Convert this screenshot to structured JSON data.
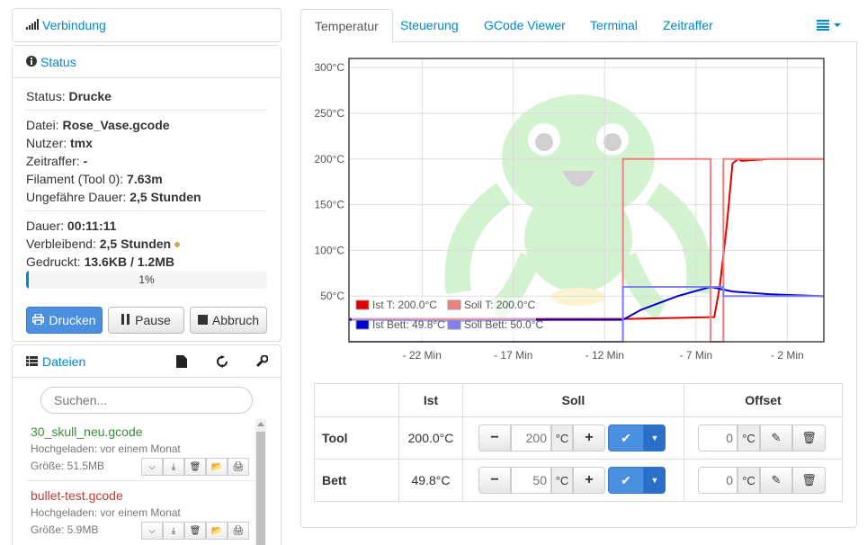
{
  "sidebar": {
    "connection_title": "Verbindung",
    "status_title": "Status",
    "status": {
      "label": "Status:",
      "value": "Drucke"
    },
    "job": [
      {
        "label": "Datei:",
        "value": "Rose_Vase.gcode"
      },
      {
        "label": "Nutzer:",
        "value": "tmx"
      },
      {
        "label": "Zeitraffer:",
        "value": "-"
      },
      {
        "label": "Filament (Tool 0):",
        "value": "7.63m"
      },
      {
        "label": "Ungefähre Dauer:",
        "value": "2,5 Stunden"
      }
    ],
    "progress_info": [
      {
        "label": "Dauer:",
        "value": "00:11:11"
      },
      {
        "label": "Verbleibend:",
        "value": "2,5 Stunden"
      },
      {
        "label": "Gedruckt:",
        "value": "13.6KB / 1.2MB"
      }
    ],
    "progress_text": "1%",
    "progress_value": 0.01,
    "buttons": {
      "print": "Drucken",
      "pause": "Pause",
      "cancel": "Abbruch"
    },
    "files_title": "Dateien",
    "search_placeholder": "Suchen...",
    "files": [
      {
        "name": "30_skull_neu.gcode",
        "uploaded": "Hochgeladen: vor einem Monat",
        "size": "Größe: 51.5MB",
        "color": "#3c8b3c"
      },
      {
        "name": "bullet-test.gcode",
        "uploaded": "Hochgeladen: vor einem Monat",
        "size": "Größe: 5.9MB",
        "color": "#c0392b"
      }
    ]
  },
  "tabs": [
    "Temperatur",
    "Steuerung",
    "GCode Viewer",
    "Terminal",
    "Zeitraffer"
  ],
  "chart_data": {
    "type": "line",
    "title": "",
    "xlabel": "",
    "ylabel": "",
    "x_ticks": [
      "- 22 Min",
      "- 17 Min",
      "- 12 Min",
      "- 7 Min",
      "- 2 Min"
    ],
    "y_ticks": [
      "50°C",
      "100°C",
      "150°C",
      "200°C",
      "250°C",
      "300°C"
    ],
    "xlim": [
      -26,
      0
    ],
    "ylim": [
      0,
      310
    ],
    "grid": true,
    "legend_position": "bottom-left",
    "series": [
      {
        "name": "Ist T: 200.0°C",
        "color": "#e00000",
        "x": [
          -26,
          -11,
          -10.8,
          -6,
          -5.7,
          -5.3,
          -5,
          -4.7,
          -4.5,
          -3,
          0
        ],
        "y": [
          25,
          25,
          25,
          27,
          60,
          130,
          195,
          200,
          198,
          200,
          200
        ]
      },
      {
        "name": "Soll T: 200.0°C",
        "color": "#f08080",
        "x": [
          -26,
          -11,
          -11,
          -6.2,
          -6.2,
          0
        ],
        "y": [
          0,
          0,
          200,
          200,
          200,
          200
        ],
        "step_points": [
          [
            -26,
            0
          ],
          [
            -11,
            0
          ],
          [
            -11,
            200
          ],
          [
            -6.2,
            200
          ],
          [
            -6.2,
            0
          ],
          [
            -5.5,
            0
          ],
          [
            -5.5,
            200
          ],
          [
            0,
            200
          ]
        ]
      },
      {
        "name": "Ist Bett: 49.8°C",
        "color": "#0000cc",
        "x": [
          -26,
          -20,
          -15,
          -11,
          -10,
          -8,
          -6.2,
          -5,
          -3,
          0
        ],
        "y": [
          24,
          23,
          24,
          24,
          35,
          50,
          60,
          55,
          52,
          49.8
        ]
      },
      {
        "name": "Soll Bett: 50.0°C",
        "color": "#8080f0",
        "x": [
          -26,
          -11,
          -11,
          -5.5,
          -5.5,
          0
        ],
        "y": [
          0,
          0,
          60,
          60,
          50,
          50
        ]
      }
    ]
  },
  "temp_table": {
    "headers": [
      "",
      "Ist",
      "Soll",
      "Offset"
    ],
    "rows": [
      {
        "name": "Tool",
        "actual": "200.0°C",
        "target_placeholder": "200",
        "unit": "°C",
        "offset_placeholder": "0",
        "offset_unit": "°C"
      },
      {
        "name": "Bett",
        "actual": "49.8°C",
        "target_placeholder": "50",
        "unit": "°C",
        "offset_placeholder": "0",
        "offset_unit": "°C"
      }
    ]
  },
  "colors": {
    "link": "#0088cc",
    "primary": "#4a8fe0"
  }
}
